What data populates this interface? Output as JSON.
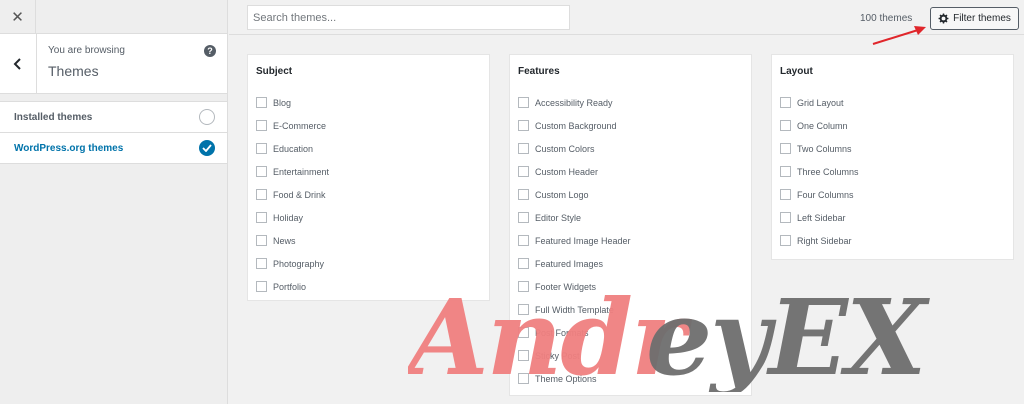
{
  "sidebar": {
    "close_icon": "close-icon",
    "back_icon": "chevron-left-icon",
    "browsing_label": "You are browsing",
    "section_title": "Themes",
    "items": [
      {
        "label": "Installed themes",
        "selected": false
      },
      {
        "label": "WordPress.org themes",
        "selected": true
      }
    ]
  },
  "topbar": {
    "search_placeholder": "Search themes...",
    "theme_count": "100 themes",
    "filter_label": "Filter themes"
  },
  "filters": {
    "subject": {
      "title": "Subject",
      "options": [
        "Blog",
        "E-Commerce",
        "Education",
        "Entertainment",
        "Food & Drink",
        "Holiday",
        "News",
        "Photography",
        "Portfolio"
      ]
    },
    "features": {
      "title": "Features",
      "options": [
        "Accessibility Ready",
        "Custom Background",
        "Custom Colors",
        "Custom Header",
        "Custom Logo",
        "Editor Style",
        "Featured Image Header",
        "Featured Images",
        "Footer Widgets",
        "Full Width Template",
        "Post Formats",
        "Sticky Post",
        "Theme Options"
      ]
    },
    "layout": {
      "title": "Layout",
      "options": [
        "Grid Layout",
        "One Column",
        "Two Columns",
        "Three Columns",
        "Four Columns",
        "Left Sidebar",
        "Right Sidebar"
      ]
    }
  },
  "watermark": {
    "text_red": "Andr",
    "text_gray": "eyEX",
    "color_red": "#f08080",
    "color_gray": "#6e6e6e"
  },
  "colors": {
    "accent": "#0073aa",
    "annotation_arrow": "#e0262b"
  }
}
